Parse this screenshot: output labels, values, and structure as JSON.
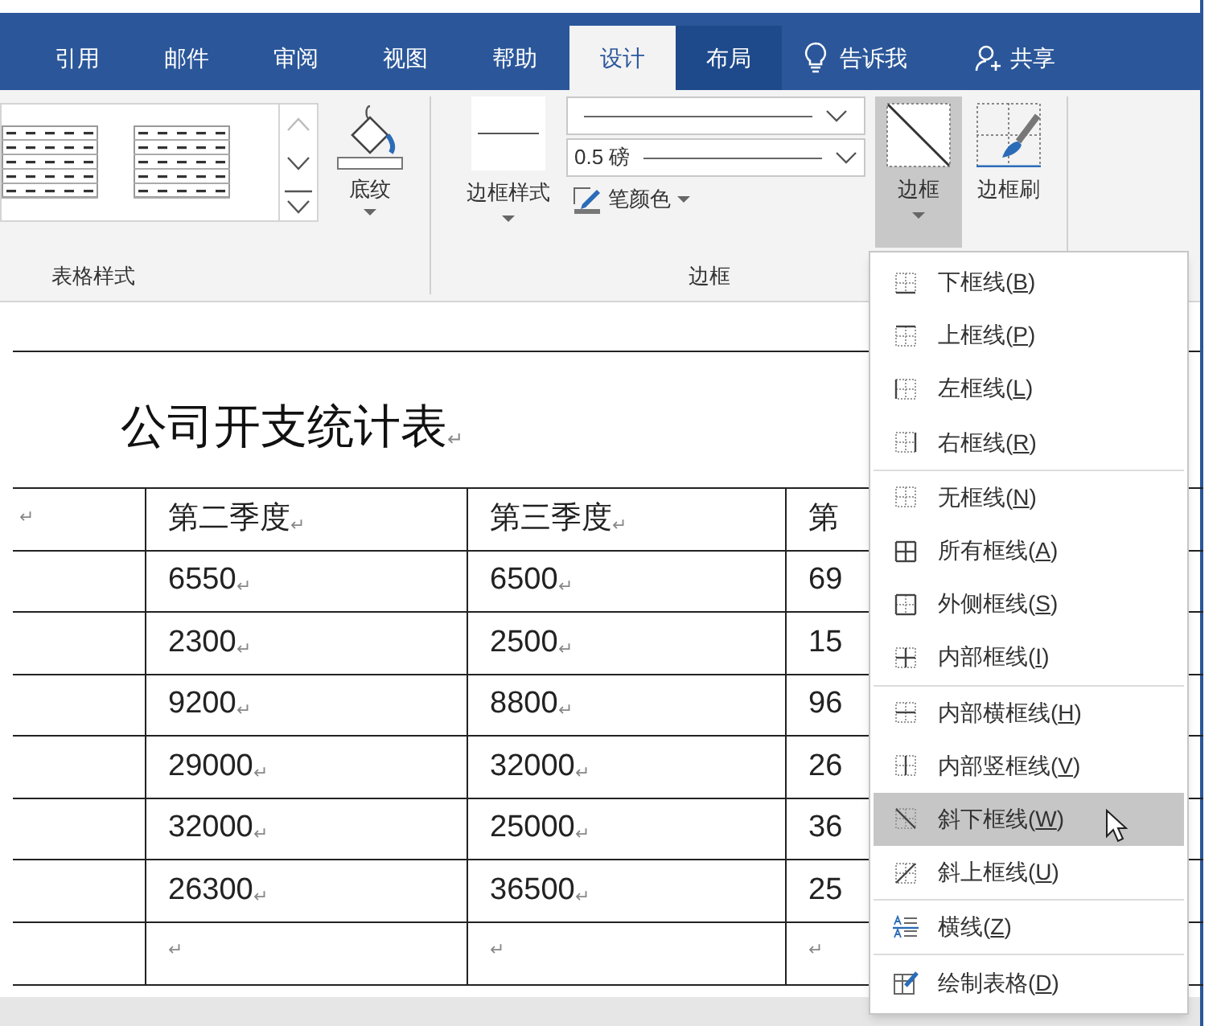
{
  "tabs": [
    {
      "label": "引用",
      "selected": false,
      "contextual": false
    },
    {
      "label": "邮件",
      "selected": false,
      "contextual": false
    },
    {
      "label": "审阅",
      "selected": false,
      "contextual": false
    },
    {
      "label": "视图",
      "selected": false,
      "contextual": false
    },
    {
      "label": "帮助",
      "selected": false,
      "contextual": false
    },
    {
      "label": "设计",
      "selected": true,
      "contextual": true
    },
    {
      "label": "布局",
      "selected": false,
      "contextual": true
    }
  ],
  "tell_me": {
    "label": "告诉我"
  },
  "share": {
    "label": "共享"
  },
  "ribbon": {
    "groups": [
      {
        "label": "表格样式"
      },
      {
        "label": "边框"
      }
    ],
    "shading_button": {
      "label": "底纹"
    },
    "border_styles_button": {
      "label": "边框样式"
    },
    "line_weight_dropdown": {
      "value": "0.5 磅"
    },
    "pen_color_button": {
      "label": "笔颜色"
    },
    "borders_button": {
      "label": "边框",
      "expanded": true
    },
    "border_painter_button": {
      "label": "边框刷"
    }
  },
  "document": {
    "title": "公司开支统计表",
    "title_mark": "↵",
    "table": {
      "rows": [
        [
          {
            "mark": "↵"
          },
          {
            "text": "第二季度",
            "mark": "↵"
          },
          {
            "text": "第三季度",
            "mark": "↵"
          },
          {
            "text": "第"
          }
        ],
        [
          null,
          {
            "text": "6550",
            "mark": "↵"
          },
          {
            "text": "6500",
            "mark": "↵"
          },
          {
            "text": "69"
          }
        ],
        [
          null,
          {
            "text": "2300",
            "mark": "↵"
          },
          {
            "text": "2500",
            "mark": "↵"
          },
          {
            "text": "15"
          }
        ],
        [
          null,
          {
            "text": "9200",
            "mark": "↵"
          },
          {
            "text": "8800",
            "mark": "↵"
          },
          {
            "text": "96"
          }
        ],
        [
          null,
          {
            "text": "29000",
            "mark": "↵"
          },
          {
            "text": "32000",
            "mark": "↵"
          },
          {
            "text": "26"
          }
        ],
        [
          null,
          {
            "text": "32000",
            "mark": "↵"
          },
          {
            "text": "25000",
            "mark": "↵"
          },
          {
            "text": "36"
          }
        ],
        [
          null,
          {
            "text": "26300",
            "mark": "↵"
          },
          {
            "text": "36500",
            "mark": "↵"
          },
          {
            "text": "25"
          }
        ],
        [
          null,
          {
            "mark": "↵"
          },
          {
            "mark": "↵"
          },
          {
            "mark": "↵"
          }
        ]
      ]
    }
  },
  "borders_menu": {
    "sections": [
      [
        {
          "label": "下框线(B)",
          "kind": "bottom",
          "selected": false
        },
        {
          "label": "上框线(P)",
          "kind": "top",
          "selected": false
        },
        {
          "label": "左框线(L)",
          "kind": "left",
          "selected": false
        },
        {
          "label": "右框线(R)",
          "kind": "right",
          "selected": false
        }
      ],
      [
        {
          "label": "无框线(N)",
          "kind": "none",
          "selected": false
        },
        {
          "label": "所有框线(A)",
          "kind": "all",
          "selected": false
        },
        {
          "label": "外侧框线(S)",
          "kind": "outside",
          "selected": false
        },
        {
          "label": "内部框线(I)",
          "kind": "inside",
          "selected": false
        }
      ],
      [
        {
          "label": "内部横框线(H)",
          "kind": "inside_h",
          "selected": false
        },
        {
          "label": "内部竖框线(V)",
          "kind": "inside_v",
          "selected": false
        },
        {
          "label": "斜下框线(W)",
          "kind": "diag_down",
          "selected": true
        },
        {
          "label": "斜上框线(U)",
          "kind": "diag_up",
          "selected": false
        }
      ],
      [
        {
          "label": "横线(Z)",
          "kind": "hline",
          "selected": false
        }
      ],
      [
        {
          "label": "绘制表格(D)",
          "kind": "draw",
          "selected": false
        }
      ]
    ]
  }
}
